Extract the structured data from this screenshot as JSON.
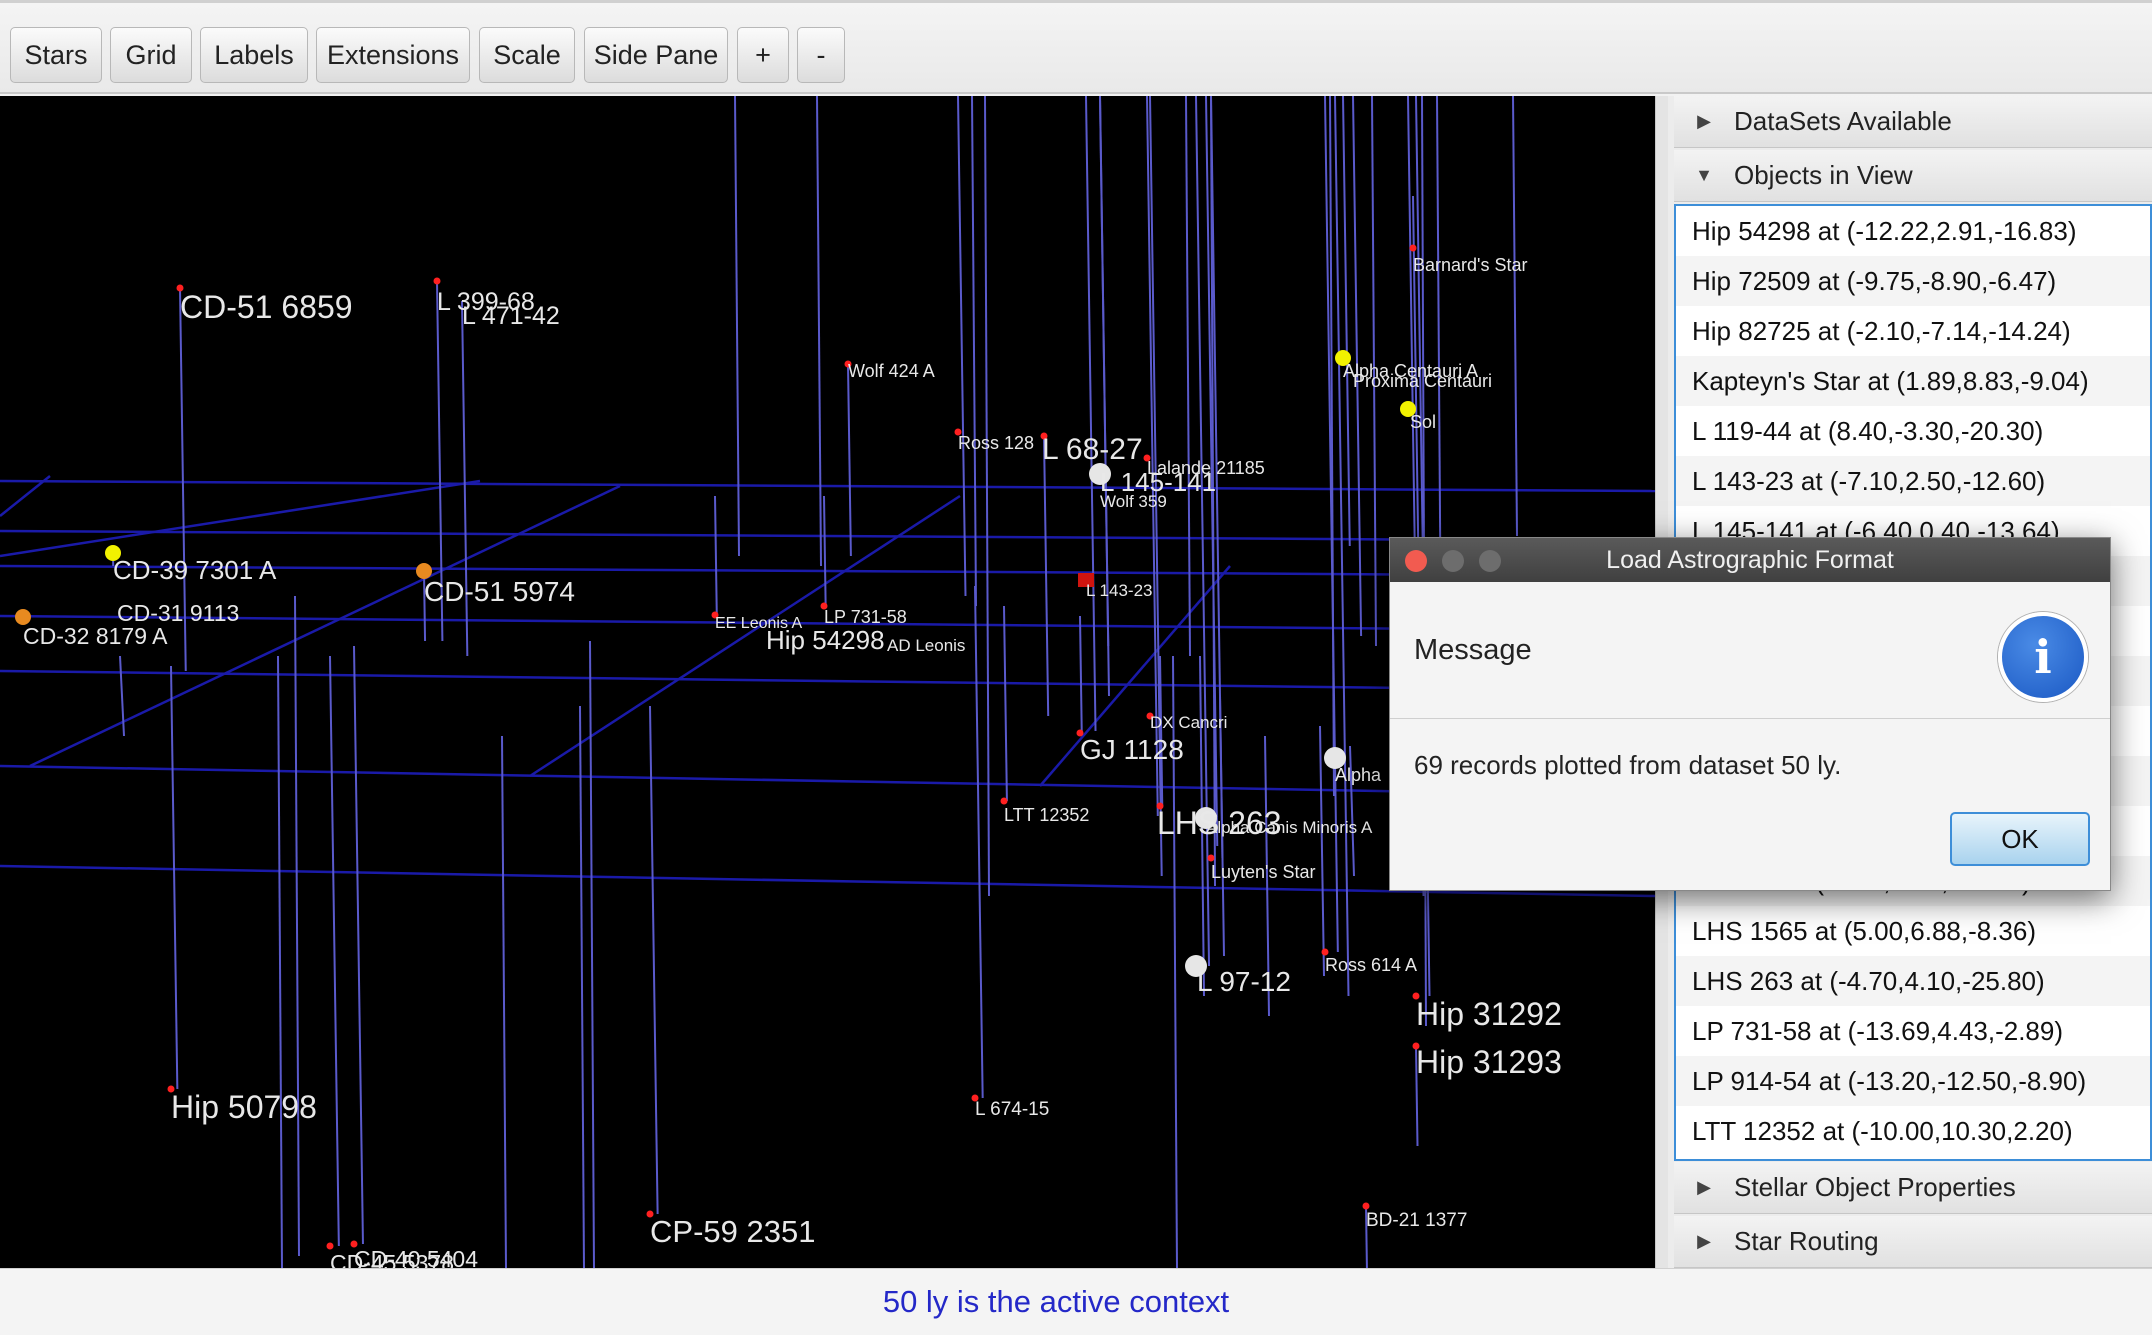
{
  "toolbar": {
    "buttons": [
      "Stars",
      "Grid",
      "Labels",
      "Extensions",
      "Scale",
      "Side Pane",
      "+",
      "-"
    ]
  },
  "viewport": {
    "grid_color": "#1a1aa8",
    "stem_color": "#5a5ac8",
    "star_labels": [
      "CD-51  6859",
      "L 399-68",
      "L 471-42",
      "Wolf  424 A",
      "Ross 128",
      "L 68-27",
      "Lalande 21185",
      "L 145-141",
      "Wolf 359",
      "Barnard's Star",
      "Alpha Centauri A",
      "Proxima Centauri",
      "Sol",
      "CD-39  7301 A",
      "CD-31  9113",
      "CD-32  8179 A",
      "CD-51  5974",
      "EE Leonis A",
      "LP 731-58",
      "Hip 54298",
      "AD Leonis",
      "L 143-23",
      "DX Cancri",
      "GJ 1128",
      "Alpha",
      "LTT 12352",
      "LHS 263",
      "Alpha Canis Minoris A",
      "Luyten's Star",
      "L 97-12",
      "Ross 614 A",
      "Hip 31292",
      "Hip 31293",
      "Hip 50798",
      "L 674-15",
      "CP-59  2351",
      "BD-21  1377",
      "CD-40  5404",
      "CD-45  5378"
    ]
  },
  "sidepane": {
    "sections": {
      "datasets": "DataSets Available",
      "objects": "Objects in View",
      "properties": "Stellar Object Properties",
      "routing": "Star Routing"
    },
    "objects_in_view": [
      "Hip 54298 at (-12.22,2.91,-16.83)",
      "Hip 72509 at (-9.75,-8.90,-6.47)",
      "Hip 82725 at (-2.10,-7.14,-14.24)",
      "Kapteyn's Star at (1.89,8.83,-9.04)",
      "L 119-44 at (8.40,-3.30,-20.30)",
      "L 143-23 at (-7.10,2.50,-12.60)",
      "L 145-141 at (-6.40,0.40,-13.64)",
      "",
      "",
      "",
      "",
      "",
      "",
      "L 97-12 at (-4.80,3.60,-20.30)",
      "LHS 1565 at (5.00,6.88,-8.36)",
      "LHS 263 at (-4.70,4.10,-25.80)",
      "LP 731-58 at (-13.69,4.43,-2.89)",
      "LP 914-54 at (-13.20,-12.50,-8.90)",
      "LTT 12352 at (-10.00,10.30,2.20)"
    ]
  },
  "status": {
    "text": "50 ly is the active context"
  },
  "dialog": {
    "title": "Load Astrographic Format",
    "header": "Message",
    "content": "69 records plotted from dataset 50 ly.",
    "ok_label": "OK",
    "icon_glyph": "i"
  }
}
